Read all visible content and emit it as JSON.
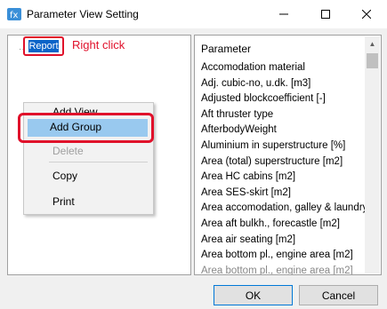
{
  "window": {
    "title": "Parameter View Setting",
    "icons": {
      "app": "app-icon",
      "minimize": "minimize-icon",
      "maximize": "maximize-icon",
      "close": "close-icon"
    }
  },
  "tree": {
    "root_label": "Report",
    "annotation": "Right click",
    "annotation_color": "#e0102a"
  },
  "context_menu": {
    "items": [
      "Add View",
      "Add Group",
      "Delete",
      "Copy",
      "Print"
    ],
    "highlighted": "Add Group",
    "disabled": [
      "Delete"
    ],
    "highlight_color": "#99c9ef"
  },
  "parameter_list": {
    "header": "Parameter",
    "items": [
      "Accomodation material",
      "Adj. cubic-no, u.dk. [m3]",
      "Adjusted blockcoefficient [-]",
      "Aft thruster type",
      "AfterbodyWeight",
      "Aluminium in superstructure [%]",
      "Area (total) superstructure [m2]",
      "Area HC cabins [m2]",
      "Area SES-skirt [m2]",
      "Area accomodation, galley & laundry [",
      "Area aft bulkh., forecastle [m2]",
      "Area air seating [m2]",
      "Area bottom pl., engine area [m2]",
      "Area bottom pl., engine area [m2]"
    ]
  },
  "buttons": {
    "ok": "OK",
    "cancel": "Cancel"
  },
  "colors": {
    "selection": "#0a64c8",
    "annotation_box": "#e0102a"
  }
}
